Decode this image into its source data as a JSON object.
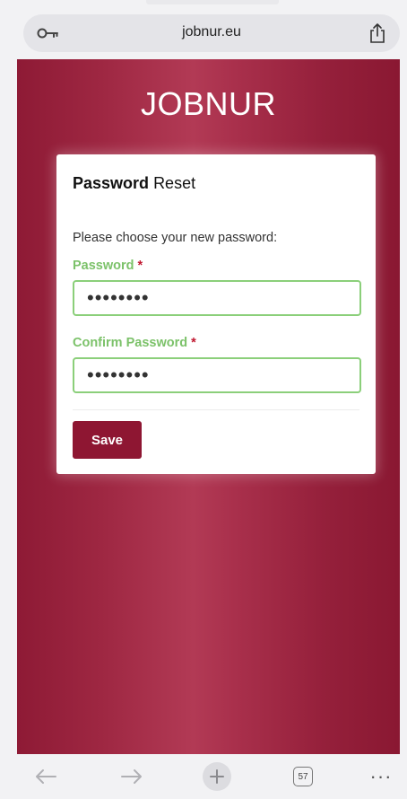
{
  "browser": {
    "url": "jobnur.eu",
    "tab_count": "57"
  },
  "page": {
    "brand": "JOBNUR",
    "card": {
      "title_bold": "Password",
      "title_normal": "Reset",
      "instructions": "Please choose your new password:",
      "password_label": "Password",
      "password_value": "••••••••",
      "confirm_label": "Confirm Password",
      "confirm_value": "••••••••",
      "required_marker": "*",
      "save_label": "Save"
    }
  },
  "colors": {
    "brand_bg": "#9e2742",
    "button_bg": "#8e1632",
    "label_green": "#7cc26a",
    "input_border": "#8bcf7a",
    "required_red": "#c0172f"
  },
  "icons": {
    "address_left": "key-icon",
    "address_right": "share-icon",
    "toolbar": [
      "back-arrow-icon",
      "forward-arrow-icon",
      "plus-icon",
      "tabs-icon",
      "more-icon"
    ]
  }
}
